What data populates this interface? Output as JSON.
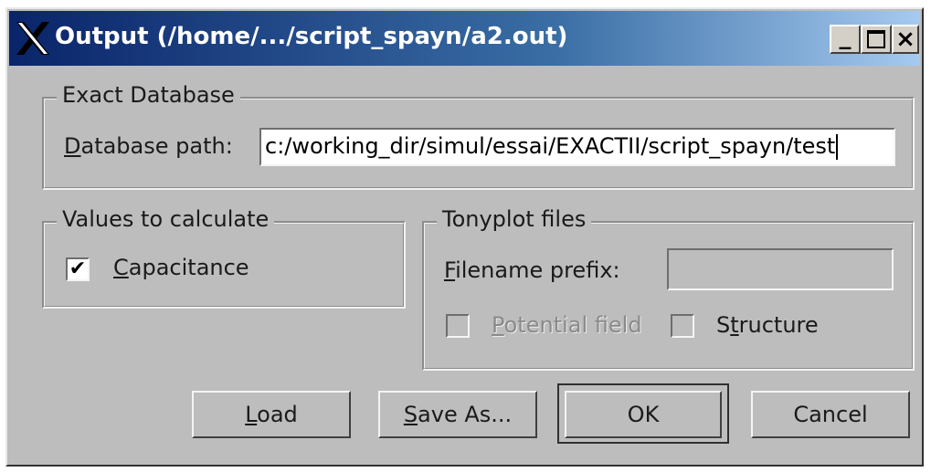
{
  "window": {
    "title": "Output (/home/.../script_spayn/a2.out)",
    "controls": {
      "minimize": "_",
      "maximize": "□",
      "close": "×"
    }
  },
  "exact_database": {
    "legend": "Exact Database",
    "path_label_mnemonic": "D",
    "path_label_rest": "atabase path:",
    "path_value": "c:/working_dir/simul/essai/EXACTII/script_spayn/test"
  },
  "values_group": {
    "legend": "Values to calculate",
    "capacitance_mnemonic": "C",
    "capacitance_rest": "apacitance",
    "capacitance_checked": true,
    "check_glyph": "✔"
  },
  "tonyplot_group": {
    "legend": "Tonyplot files",
    "prefix_label_mnemonic": "F",
    "prefix_label_rest": "ilename prefix:",
    "prefix_value": "",
    "potential_mnemonic": "P",
    "potential_rest": "otential field",
    "structure_pre": "S",
    "structure_mnemonic": "t",
    "structure_rest": "ructure"
  },
  "buttons": {
    "load_mnemonic": "L",
    "load_rest": "oad",
    "save_mnemonic": "S",
    "save_rest": "ave As...",
    "ok": "OK",
    "cancel": "Cancel"
  }
}
